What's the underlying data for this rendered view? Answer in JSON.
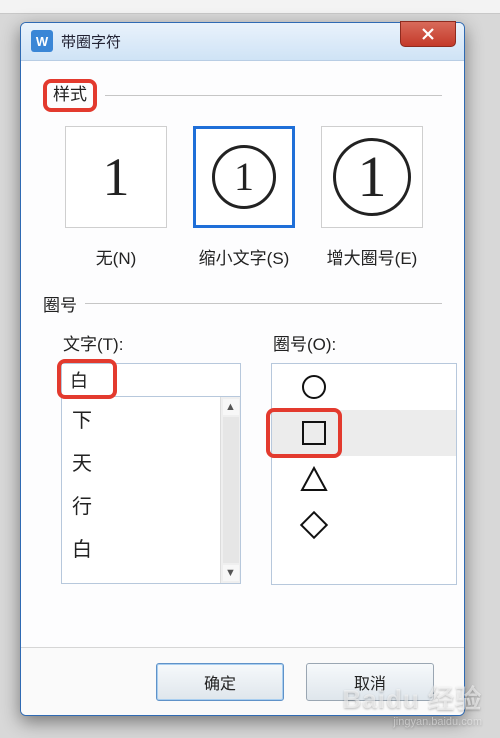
{
  "dialog": {
    "app_icon_letter": "W",
    "title": "带圈字符"
  },
  "style_section": {
    "label": "样式",
    "options": {
      "none": {
        "glyph": "1",
        "caption": "无(N)"
      },
      "shrink": {
        "glyph": "1",
        "caption": "缩小文字(S)",
        "selected": true
      },
      "enlarge": {
        "glyph": "1",
        "caption": "增大圈号(E)"
      }
    }
  },
  "encloser_section": {
    "label": "圈号",
    "text_column": {
      "label": "文字(T):",
      "value": "白",
      "items": [
        "下",
        "天",
        "行",
        "白"
      ]
    },
    "shape_column": {
      "label": "圈号(O):",
      "items": [
        {
          "shape": "circle",
          "selected": false
        },
        {
          "shape": "square",
          "selected": true
        },
        {
          "shape": "triangle",
          "selected": false
        },
        {
          "shape": "diamond",
          "selected": false
        }
      ]
    }
  },
  "buttons": {
    "ok": "确定",
    "cancel": "取消"
  },
  "watermark": {
    "brand": "Baidu 经验",
    "url": "jingyan.baidu.com"
  }
}
